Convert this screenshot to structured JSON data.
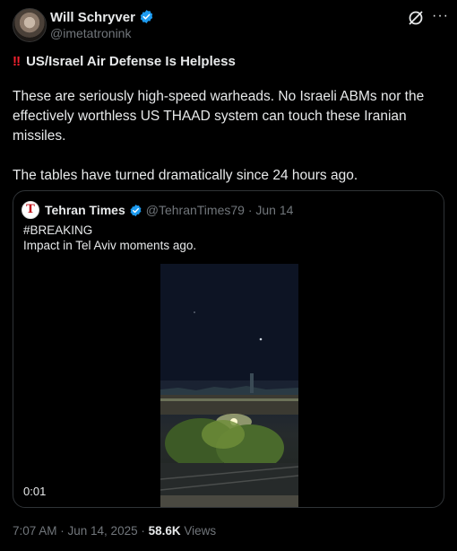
{
  "author": {
    "name": "Will Schryver",
    "handle": "@imetatronink"
  },
  "post": {
    "headline_icon": "double-exclamation",
    "headline": "US/Israel Air Defense Is Helpless",
    "paragraphs": [
      "These are seriously high-speed warheads. No Israeli ABMs nor the effectively worthless US THAAD system can touch these Iranian missiles.",
      "The tables have turned dramatically since 24 hours ago."
    ]
  },
  "quoted": {
    "avatar_letter": "T",
    "name": "Tehran Times",
    "handle": "@TehranTimes79",
    "date": "Jun 14",
    "line1": "#BREAKING",
    "line2": "Impact in Tel Aviv moments ago.",
    "video_time": "0:01"
  },
  "footer": {
    "time": "7:07 AM · Jun 14, 2025 ·",
    "views_count": "58.6K",
    "views_label": "Views"
  },
  "colors": {
    "background": "#000000",
    "verified": "#1d9bf0",
    "muted": "#71767b",
    "alert": "#f4212e"
  }
}
